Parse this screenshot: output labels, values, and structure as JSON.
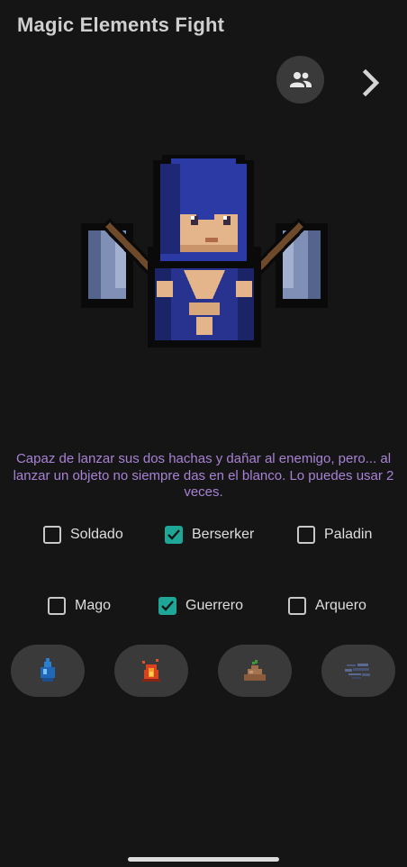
{
  "app": {
    "title": "Magic Elements Fight"
  },
  "header": {
    "group_icon": "group-icon",
    "next_icon": "chevron-right-icon"
  },
  "character": {
    "image": "pixel-hooded-warrior-with-two-axes",
    "description": "Capaz de lanzar sus dos hachas y dañar al enemigo, pero... al lanzar un objeto no siempre das en el blanco. Lo puedes usar 2 veces."
  },
  "classes_row1": [
    {
      "label": "Soldado",
      "checked": false
    },
    {
      "label": "Berserker",
      "checked": true
    },
    {
      "label": "Paladin",
      "checked": false
    }
  ],
  "classes_row2": [
    {
      "label": "Mago",
      "checked": false
    },
    {
      "label": "Guerrero",
      "checked": true
    },
    {
      "label": "Arquero",
      "checked": false
    }
  ],
  "elements": [
    {
      "name": "water",
      "icon": "water-drop-icon"
    },
    {
      "name": "fire",
      "icon": "fire-icon"
    },
    {
      "name": "earth",
      "icon": "earth-mound-icon"
    },
    {
      "name": "air",
      "icon": "wind-icon"
    }
  ],
  "colors": {
    "background": "#151515",
    "accent": "#1ea696",
    "description_text": "#a882d4",
    "button_bg": "#3a3a3a"
  }
}
